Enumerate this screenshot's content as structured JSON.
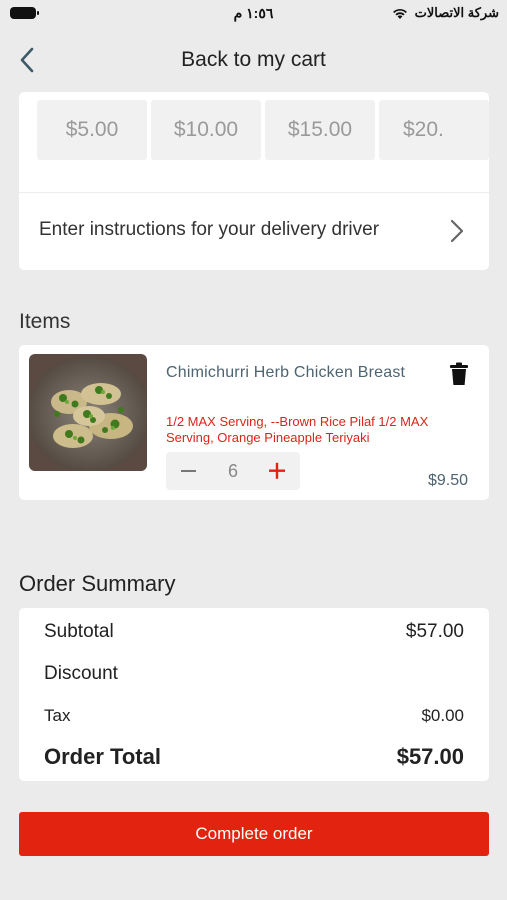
{
  "status_bar": {
    "time": "١:٥٦ م",
    "carrier": "شركة الاتصالات"
  },
  "nav": {
    "title": "Back to my cart"
  },
  "tips": {
    "options": [
      "$5.00",
      "$10.00",
      "$15.00",
      "$20."
    ]
  },
  "instructions": {
    "label": "Enter instructions for your delivery driver"
  },
  "items_section": {
    "title": "Items"
  },
  "item": {
    "name": "Chimichurri Herb Chicken Breast",
    "options": "1/2 MAX Serving, --Brown Rice Pilaf 1/2 MAX Serving, Orange Pineapple Teriyaki",
    "quantity": "6",
    "price": "$9.50"
  },
  "summary": {
    "title": "Order Summary",
    "subtotal_label": "Subtotal",
    "subtotal_value": "$57.00",
    "discount_label": "Discount",
    "discount_value": "",
    "tax_label": "Tax",
    "tax_value": "$0.00",
    "total_label": "Order Total",
    "total_value": "$57.00"
  },
  "actions": {
    "complete_label": "Complete order"
  },
  "colors": {
    "accent": "#e1230f",
    "option_text": "#d9251a",
    "item_text": "#4e6470",
    "background": "#ebebeb"
  }
}
